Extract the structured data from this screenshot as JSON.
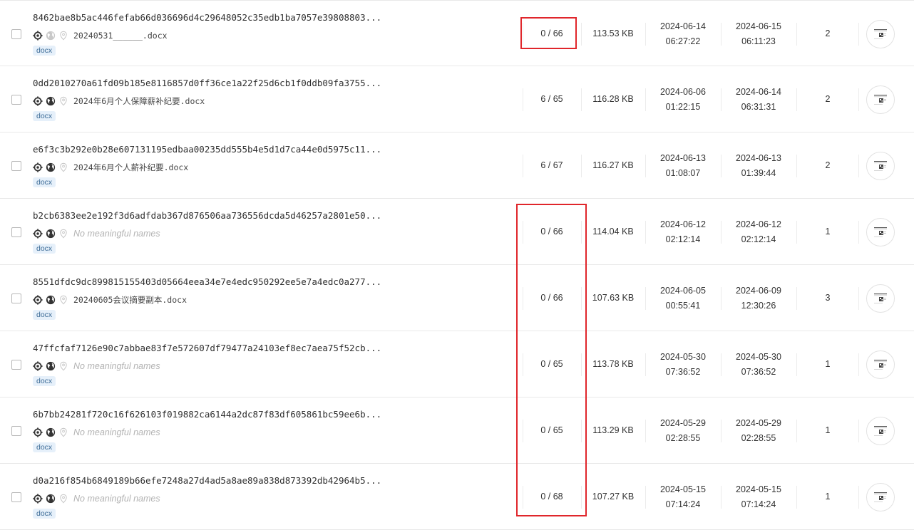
{
  "rows": [
    {
      "hash": "8462bae8b5ac446fefab66d036696d4c29648052c35edb1ba7057e39808803...",
      "filename": "20240531______.docx",
      "tag": "docx",
      "detections": "0 / 66",
      "size": "113.53 KB",
      "first_seen": [
        "2024-06-14",
        "06:27:22"
      ],
      "last_seen": [
        "2024-06-15",
        "06:11:23"
      ],
      "count": "2",
      "icon_active": [
        true,
        false,
        false
      ]
    },
    {
      "hash": "0dd2010270a61fd09b185e8116857d0ff36ce1a22f25d6cb1f0ddb09fa3755...",
      "filename": "2024年6月个人保障薪补纪要.docx",
      "tag": "docx",
      "detections": "6 / 65",
      "size": "116.28 KB",
      "first_seen": [
        "2024-06-06",
        "01:22:15"
      ],
      "last_seen": [
        "2024-06-14",
        "06:31:31"
      ],
      "count": "2",
      "icon_active": [
        true,
        true,
        false
      ]
    },
    {
      "hash": "e6f3c3b292e0b28e607131195edbaa00235dd555b4e5d1d7ca44e0d5975c11...",
      "filename": "2024年6月个人薪补纪要.docx",
      "tag": "docx",
      "detections": "6 / 67",
      "size": "116.27 KB",
      "first_seen": [
        "2024-06-13",
        "01:08:07"
      ],
      "last_seen": [
        "2024-06-13",
        "01:39:44"
      ],
      "count": "2",
      "icon_active": [
        true,
        true,
        false
      ]
    },
    {
      "hash": "b2cb6383ee2e192f3d6adfdab367d876506aa736556dcda5d46257a2801e50...",
      "filename": "No meaningful names",
      "filename_empty": true,
      "tag": "docx",
      "detections": "0 / 66",
      "size": "114.04 KB",
      "first_seen": [
        "2024-06-12",
        "02:12:14"
      ],
      "last_seen": [
        "2024-06-12",
        "02:12:14"
      ],
      "count": "1",
      "icon_active": [
        true,
        true,
        false
      ]
    },
    {
      "hash": "8551dfdc9dc899815155403d05664eea34e7e4edc950292ee5e7a4edc0a277...",
      "filename": "20240605会议摘要副本.docx",
      "tag": "docx",
      "detections": "0 / 66",
      "size": "107.63 KB",
      "first_seen": [
        "2024-06-05",
        "00:55:41"
      ],
      "last_seen": [
        "2024-06-09",
        "12:30:26"
      ],
      "count": "3",
      "icon_active": [
        true,
        true,
        false
      ]
    },
    {
      "hash": "47ffcfaf7126e90c7abbae83f7e572607df79477a24103ef8ec7aea75f52cb...",
      "filename": "No meaningful names",
      "filename_empty": true,
      "tag": "docx",
      "detections": "0 / 65",
      "size": "113.78 KB",
      "first_seen": [
        "2024-05-30",
        "07:36:52"
      ],
      "last_seen": [
        "2024-05-30",
        "07:36:52"
      ],
      "count": "1",
      "icon_active": [
        true,
        true,
        false
      ]
    },
    {
      "hash": "6b7bb24281f720c16f626103f019882ca6144a2dc87f83df605861bc59ee6b...",
      "filename": "No meaningful names",
      "filename_empty": true,
      "tag": "docx",
      "detections": "0 / 65",
      "size": "113.29 KB",
      "first_seen": [
        "2024-05-29",
        "02:28:55"
      ],
      "last_seen": [
        "2024-05-29",
        "02:28:55"
      ],
      "count": "1",
      "icon_active": [
        true,
        true,
        false
      ]
    },
    {
      "hash": "d0a216f854b6849189b66efe7248a27d4ad5a8ae89a838d873392db42964b5...",
      "filename": "No meaningful names",
      "filename_empty": true,
      "tag": "docx",
      "detections": "0 / 68",
      "size": "107.27 KB",
      "first_seen": [
        "2024-05-15",
        "07:14:24"
      ],
      "last_seen": [
        "2024-05-15",
        "07:14:24"
      ],
      "count": "1",
      "icon_active": [
        true,
        true,
        false
      ]
    }
  ],
  "colors": {
    "highlight": "#e0262b",
    "icon_active": "#333333",
    "icon_inactive": "#c8c8c8",
    "tag_bg": "#e6f0fa"
  },
  "icons": [
    "gear-icon",
    "globe-icon",
    "location-pin-icon"
  ]
}
